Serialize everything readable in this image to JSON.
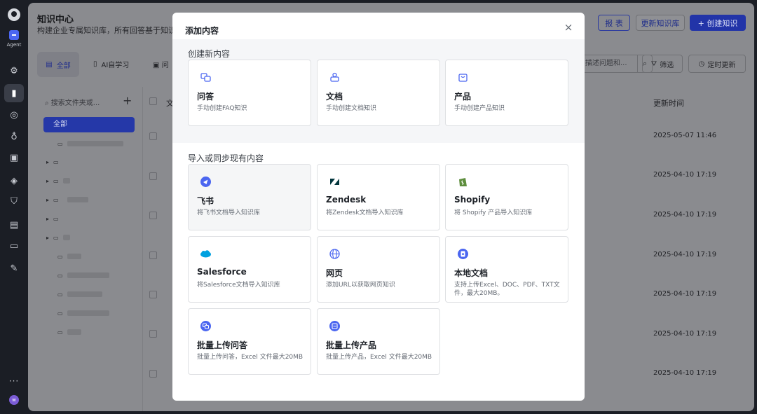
{
  "rail": {
    "agent_label": "Agent",
    "more": "···",
    "avatar_initial": "w",
    "icons": [
      "logo-icon",
      "gear-icon",
      "book-icon",
      "bulb-icon",
      "robot-icon",
      "code-icon",
      "cube-icon",
      "shield-icon",
      "inbox-icon",
      "monitor-icon",
      "wrench-icon"
    ]
  },
  "header": {
    "title": "知识中心",
    "description": "构建企业专属知识库，所有回答基于知识生",
    "report_button": "报 表",
    "update_button": "更新知识库",
    "create_button": "+ 创建知识"
  },
  "tabs": [
    {
      "label": "全部"
    },
    {
      "label": "AI自学习"
    },
    {
      "label": "问"
    }
  ],
  "toolbar": {
    "search_placeholder": "描述问题和...",
    "filter_label": "筛选",
    "schedule_label": "定时更新"
  },
  "sidebar": {
    "search_placeholder": "搜索文件夹或...",
    "add_label": "+",
    "all_label": "全部"
  },
  "table": {
    "column_update_time": "更新时间",
    "column_first": "文",
    "dates": [
      "2025-05-07 11:46",
      "2025-04-10 17:19",
      "2025-04-10 17:19",
      "2025-04-10 17:19",
      "2025-04-10 17:19",
      "2025-04-10 17:19",
      "2025-04-10 17:19"
    ]
  },
  "modal": {
    "title": "添加内容",
    "close_label": "×",
    "create_section_title": "创建新内容",
    "import_section_title": "导入或同步现有内容",
    "create_cards": [
      {
        "title": "问答",
        "desc": "手动创建FAQ知识",
        "icon": "qa-icon"
      },
      {
        "title": "文档",
        "desc": "手动创建文档知识",
        "icon": "document-icon"
      },
      {
        "title": "产品",
        "desc": "手动创建产品知识",
        "icon": "product-icon"
      }
    ],
    "import_cards": [
      {
        "title": "飞书",
        "desc": "将飞书文档导入知识库",
        "icon": "feishu-icon"
      },
      {
        "title": "Zendesk",
        "desc": "将Zendesk文档导入知识库",
        "icon": "zendesk-icon"
      },
      {
        "title": "Shopify",
        "desc": "将 Shopify 产品导入知识库",
        "icon": "shopify-icon"
      },
      {
        "title": "Salesforce",
        "desc": "将Salesforce文档导入知识库",
        "icon": "salesforce-icon"
      },
      {
        "title": "网页",
        "desc": "添加URL以获取网页知识",
        "icon": "globe-icon"
      },
      {
        "title": "本地文档",
        "desc": "支持上传Excel、DOC、PDF、TXT文件，最大20MB。",
        "icon": "local-file-icon"
      },
      {
        "title": "批量上传问答",
        "desc": "批量上传问答，Excel 文件最大20MB",
        "icon": "bulk-qa-icon"
      },
      {
        "title": "批量上传产品",
        "desc": "批量上传产品，Excel 文件最大20MB",
        "icon": "bulk-product-icon"
      }
    ]
  },
  "colors": {
    "accent": "#4b66f0",
    "overlay": "#8a8b8f",
    "rail": "#1b1e25"
  }
}
